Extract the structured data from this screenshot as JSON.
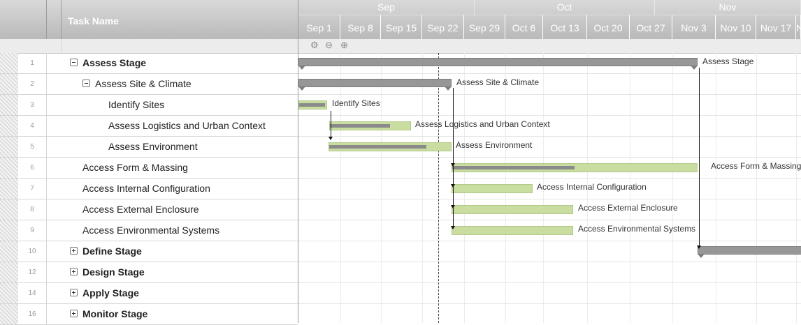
{
  "grid": {
    "header_title": "Task Name",
    "rows": [
      {
        "num": "1",
        "name": "Assess Stage",
        "toggle": "minus",
        "indent": 0,
        "bold": true
      },
      {
        "num": "2",
        "name": "Assess Site & Climate",
        "toggle": "minus",
        "indent": 1,
        "bold": false
      },
      {
        "num": "3",
        "name": "Identify Sites",
        "toggle": "none",
        "indent": 2,
        "bold": false
      },
      {
        "num": "4",
        "name": "Assess Logistics and Urban Context",
        "toggle": "none",
        "indent": 2,
        "bold": false
      },
      {
        "num": "5",
        "name": "Assess Environment",
        "toggle": "none",
        "indent": 2,
        "bold": false
      },
      {
        "num": "6",
        "name": "Access Form & Massing",
        "toggle": "none",
        "indent": 1,
        "bold": false
      },
      {
        "num": "7",
        "name": "Access Internal Configuration",
        "toggle": "none",
        "indent": 1,
        "bold": false
      },
      {
        "num": "8",
        "name": "Access External Enclosure",
        "toggle": "none",
        "indent": 1,
        "bold": false
      },
      {
        "num": "9",
        "name": "Access Environmental Systems",
        "toggle": "none",
        "indent": 1,
        "bold": false
      },
      {
        "num": "10",
        "name": "Define Stage",
        "toggle": "plus",
        "indent": 0,
        "bold": true
      },
      {
        "num": "12",
        "name": "Design Stage",
        "toggle": "plus",
        "indent": 0,
        "bold": true
      },
      {
        "num": "14",
        "name": "Apply Stage",
        "toggle": "plus",
        "indent": 0,
        "bold": true
      },
      {
        "num": "16",
        "name": "Monitor Stage",
        "toggle": "plus",
        "indent": 0,
        "bold": true
      }
    ]
  },
  "timeline": {
    "months": [
      "Sep",
      "Oct",
      "Nov"
    ],
    "weeks": [
      "Sep 1",
      "Sep 8",
      "Sep 15",
      "Sep 22",
      "Sep 29",
      "Oct 6",
      "Oct 13",
      "Oct 20",
      "Oct 27",
      "Nov 3",
      "Nov 10",
      "Nov 17",
      "N"
    ],
    "tools": [
      "gear-icon",
      "zoom-out-icon",
      "zoom-in-icon"
    ]
  },
  "bars": [
    {
      "row": 0,
      "label": "Assess Stage",
      "type": "summary"
    },
    {
      "row": 1,
      "label": "Assess Site & Climate",
      "type": "summary"
    },
    {
      "row": 2,
      "label": "Identify Sites",
      "type": "task",
      "progress": 0.95
    },
    {
      "row": 3,
      "label": "Assess Logistics and Urban Context",
      "type": "task",
      "progress": 0.75
    },
    {
      "row": 4,
      "label": "Assess Environment",
      "type": "task",
      "progress": 0.8
    },
    {
      "row": 5,
      "label": "Access Form & Massing",
      "type": "task",
      "progress": 0.5
    },
    {
      "row": 6,
      "label": "Access Internal Configuration",
      "type": "task",
      "progress": 0
    },
    {
      "row": 7,
      "label": "Access External Enclosure",
      "type": "task",
      "progress": 0
    },
    {
      "row": 8,
      "label": "Access Environmental Systems",
      "type": "task",
      "progress": 0
    },
    {
      "row": 9,
      "label": "",
      "type": "summary"
    }
  ],
  "colors": {
    "task": "#c8dd9f",
    "summary": "#979797",
    "header": "#bdbdbd",
    "progress": "#8a8a8a"
  }
}
